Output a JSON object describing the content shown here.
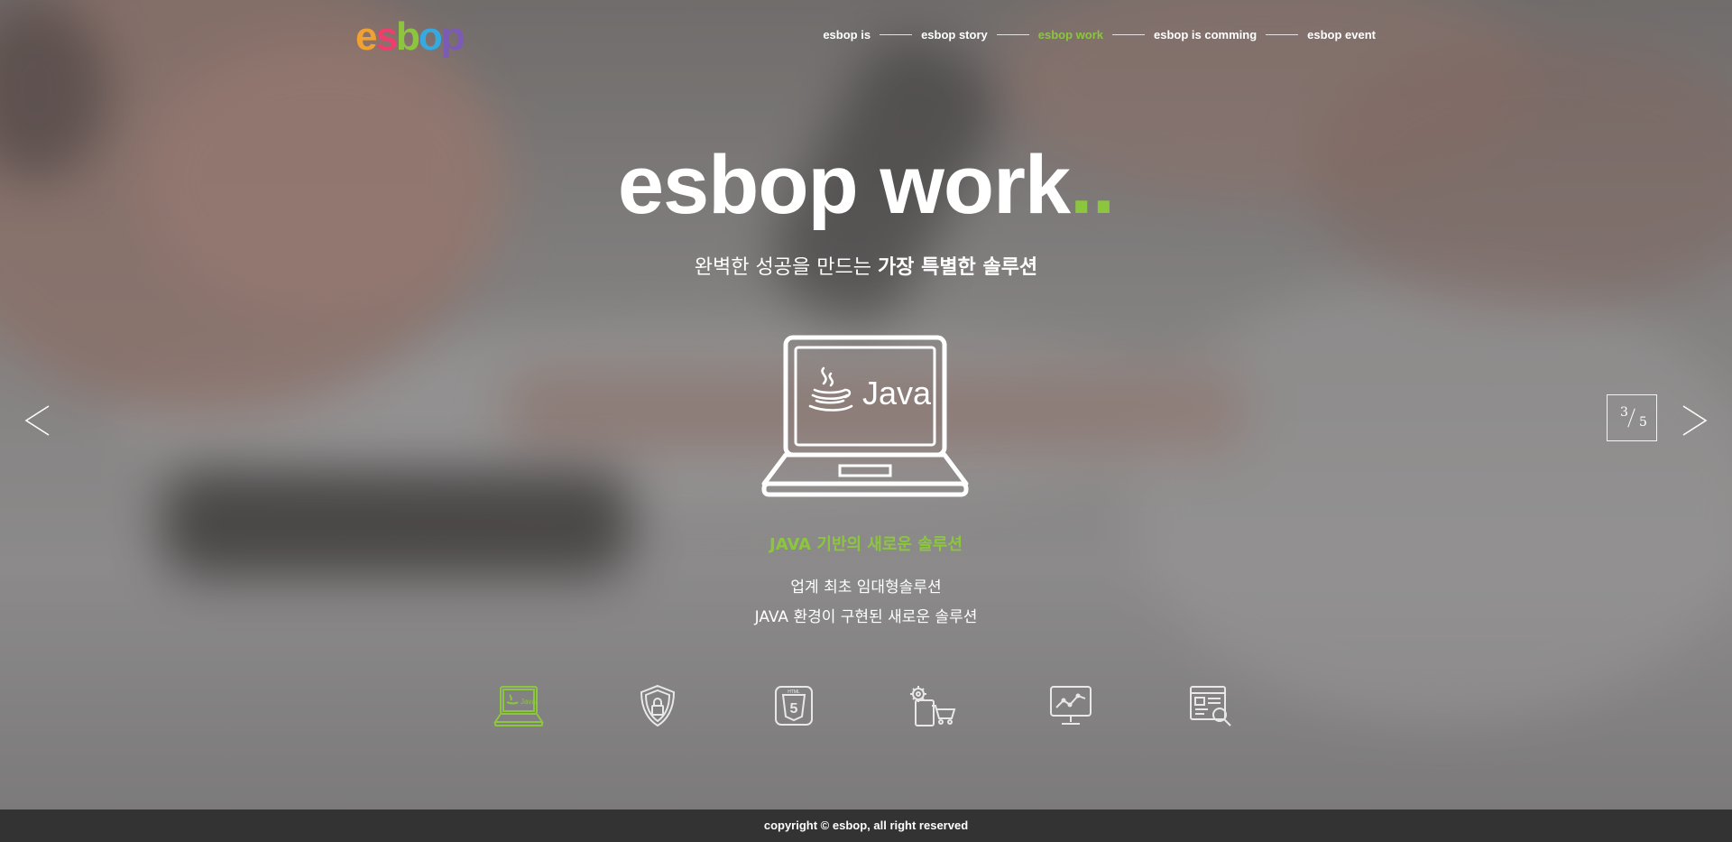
{
  "brand": {
    "logo_letters": [
      "e",
      "s",
      "b",
      "o",
      "p"
    ]
  },
  "nav": {
    "items": [
      {
        "label": "esbop is"
      },
      {
        "label": "esbop story"
      },
      {
        "label": "esbop work"
      },
      {
        "label": "esbop is comming"
      },
      {
        "label": "esbop event"
      }
    ],
    "active_index": 2,
    "active_color": "#8cc63f"
  },
  "hero": {
    "title": "esbop work",
    "title_dots": "..",
    "subtitle_light": "완벽한 성공을 만드는 ",
    "subtitle_bold": "가장 특별한 솔루션",
    "laptop_screen_label": "Java"
  },
  "feature": {
    "title": "JAVA 기반의 새로운 솔루션",
    "lines": [
      "업계 최초 임대형솔루션",
      "JAVA 환경이 구현된 새로운 솔루션"
    ]
  },
  "slider": {
    "current": "3",
    "total": "5",
    "prev_icon": "chevron-left-icon",
    "next_icon": "chevron-right-icon"
  },
  "feature_icons": [
    {
      "name": "java-laptop-icon",
      "active": true
    },
    {
      "name": "security-shield-icon",
      "active": false
    },
    {
      "name": "html5-icon",
      "active": false
    },
    {
      "name": "settings-cart-icon",
      "active": false
    },
    {
      "name": "chart-monitor-icon",
      "active": false
    },
    {
      "name": "document-search-icon",
      "active": false
    }
  ],
  "footer": {
    "copyright": "copyright © esbop, all right reserved"
  },
  "colors": {
    "accent": "#8cc63f",
    "footer_bg": "#333333"
  }
}
